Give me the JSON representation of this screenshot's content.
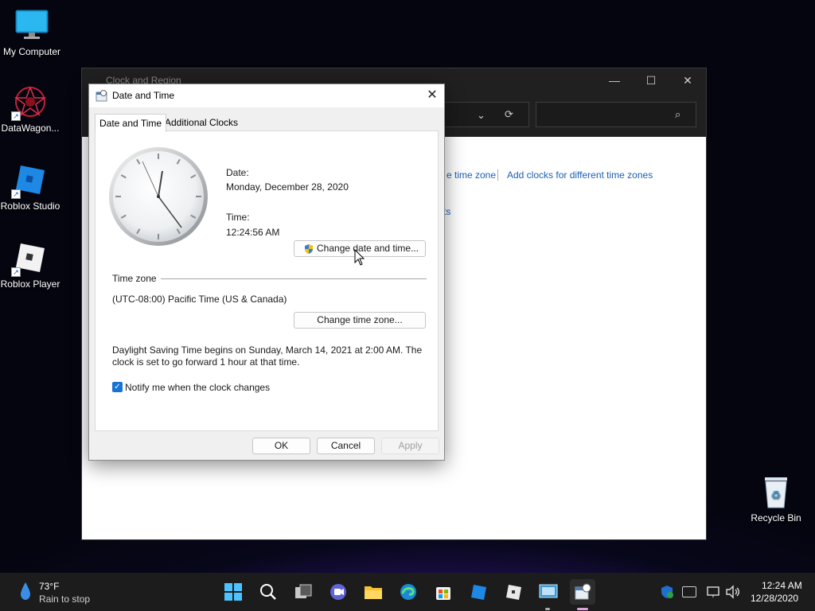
{
  "desktop": {
    "icons": [
      {
        "label": "My Computer"
      },
      {
        "label": "DataWagon..."
      },
      {
        "label": "Roblox Studio"
      },
      {
        "label": "Roblox Player"
      },
      {
        "label": "Recycle Bin"
      }
    ]
  },
  "bg_window": {
    "title": "Clock and Region",
    "link_timezone": "e time zone",
    "link_additional": "Add clocks for different time zones",
    "link_fragment": "ts"
  },
  "dialog": {
    "title": "Date and Time",
    "tabs": [
      {
        "label": "Date and Time"
      },
      {
        "label": "Additional Clocks"
      }
    ],
    "date_label": "Date:",
    "date_value": "Monday, December 28, 2020",
    "time_label": "Time:",
    "time_value": "12:24:56 AM",
    "change_datetime_label": "Change date and time...",
    "timezone_header": "Time zone",
    "timezone_value": "(UTC-08:00) Pacific Time (US & Canada)",
    "change_timezone_label": "Change time zone...",
    "dst_line1": "Daylight Saving Time begins on Sunday, March 14, 2021 at 2:00 AM. The",
    "dst_line2": "clock is set to go forward 1 hour at that time.",
    "notify_label": "Notify me when the clock changes",
    "notify_checked": true,
    "ok_label": "OK",
    "cancel_label": "Cancel",
    "apply_label": "Apply"
  },
  "taskbar": {
    "weather_temp": "73°F",
    "weather_desc": "Rain to stop",
    "clock_time": "12:24 AM",
    "clock_date": "12/28/2020",
    "apps": [
      "start-icon",
      "search-icon",
      "task-view-icon",
      "chat-icon",
      "file-explorer-icon",
      "edge-icon",
      "store-icon",
      "roblox-studio-icon",
      "roblox-player-icon",
      "control-panel-icon",
      "date-time-icon"
    ]
  },
  "colors": {
    "accent": "#1a73d4",
    "link": "#1a5fb4",
    "taskbar": "#1c1c1c"
  }
}
